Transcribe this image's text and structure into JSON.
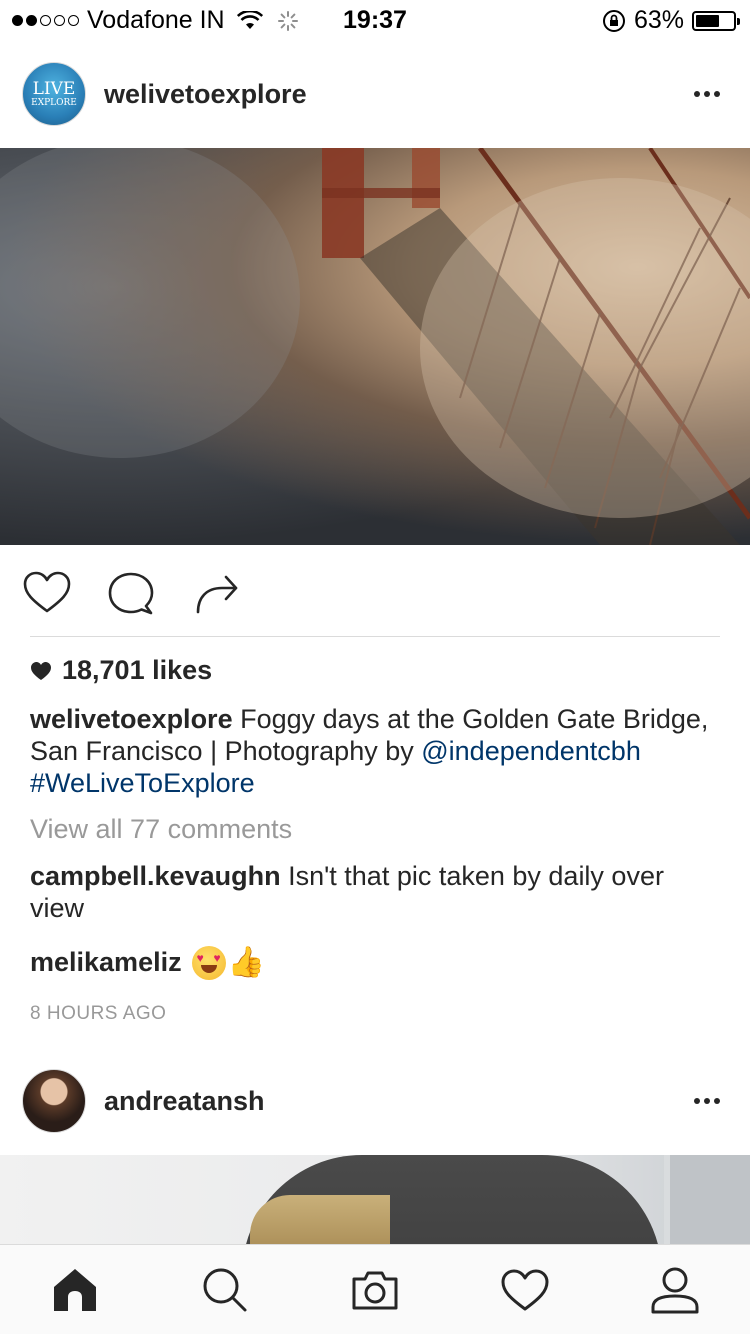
{
  "status_bar": {
    "carrier": "Vodafone IN",
    "time": "19:37",
    "battery": "63%",
    "battery_level": 0.63,
    "signal_bars_filled": 2,
    "signal_bars_total": 5
  },
  "post1": {
    "username": "welivetoexplore",
    "avatar_text_line1": "LIVE",
    "avatar_text_line2": "EXPLORE",
    "likes": "18,701 likes",
    "caption_user": "welivetoexplore",
    "caption_text": "Foggy days at the Golden Gate Bridge, San Francisco | Photography by",
    "caption_mention": "@independentcbh",
    "caption_hashtag": "#WeLiveToExplore",
    "view_all_comments": "View all 77 comments",
    "comments": [
      {
        "user": "campbell.kevaughn",
        "text": "Isn't that pic taken by daily over view"
      },
      {
        "user": "melikameliz",
        "text": ""
      }
    ],
    "timestamp": "8 HOURS AGO"
  },
  "post2": {
    "username": "andreatansh"
  },
  "icons": {
    "like": "heart-outline-icon",
    "comment": "comment-bubble-icon",
    "share": "share-arrow-icon",
    "more": "more-horizontal-icon",
    "tabs": [
      "home-icon",
      "search-icon",
      "camera-icon",
      "activity-heart-icon",
      "profile-icon"
    ]
  },
  "colors": {
    "link": "#003569",
    "muted": "#999999",
    "text": "#262626"
  }
}
